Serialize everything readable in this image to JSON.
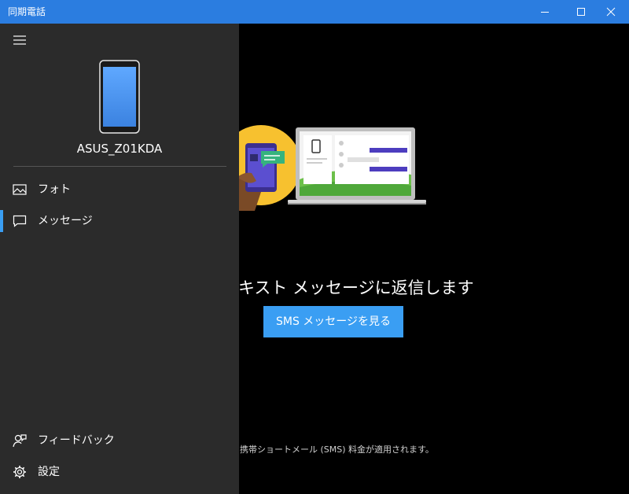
{
  "window": {
    "title": "同期電話"
  },
  "sidebar": {
    "device_name": "ASUS_Z01KDA",
    "items": [
      {
        "label": "フォト",
        "icon": "photo-icon",
        "active": false
      },
      {
        "label": "メッセージ",
        "icon": "message-icon",
        "active": true
      }
    ],
    "bottom_items": [
      {
        "label": "フィードバック",
        "icon": "feedback-icon"
      },
      {
        "label": "設定",
        "icon": "gear-icon"
      }
    ]
  },
  "main": {
    "headline": "テキスト メッセージに返信します",
    "button_label": "SMS メッセージを見る",
    "footnote": "準の携帯ショートメール (SMS) 料金が適用されます。"
  },
  "colors": {
    "titlebar": "#2b7de0",
    "accent": "#3a9ef3",
    "sidepane": "#2b2b2b",
    "background": "#000000"
  }
}
